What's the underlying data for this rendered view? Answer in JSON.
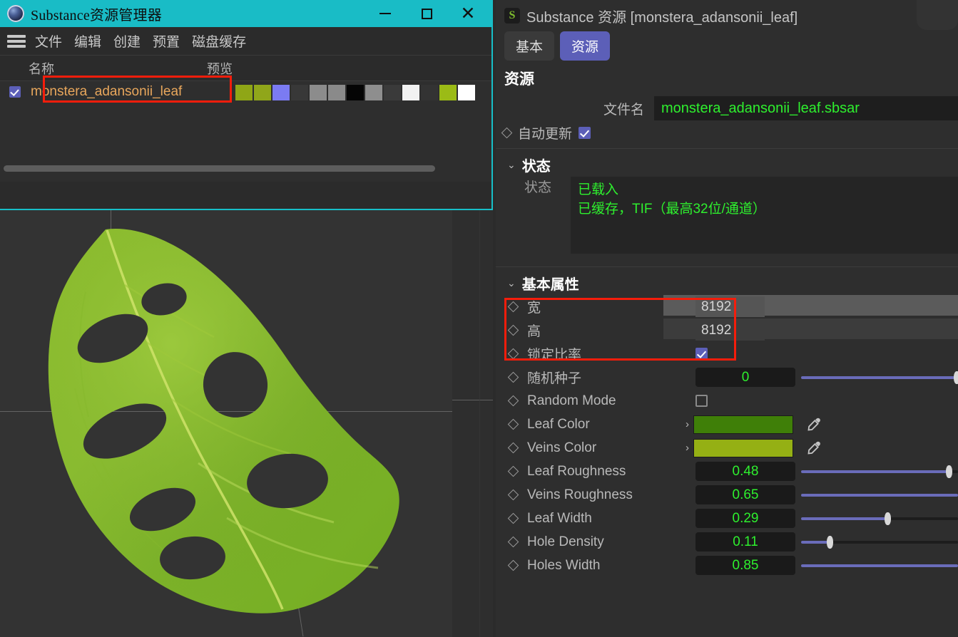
{
  "left_window": {
    "title": "Substance资源管理器",
    "app_icon": "substance-sphere-icon",
    "window_buttons": {
      "minimize": "minimize-icon",
      "maximize": "maximize-icon",
      "close": "close-icon"
    },
    "menu": {
      "hamburger": "hamburger-icon",
      "items": [
        "文件",
        "编辑",
        "创建",
        "预置",
        "磁盘缓存"
      ]
    },
    "list": {
      "columns": [
        "名称",
        "预览"
      ],
      "rows": [
        {
          "checked": true,
          "name": "monstera_adansonii_leaf",
          "highlighted": true
        }
      ],
      "thumbnail_colors": [
        "#8fa616",
        "#90a61a",
        "#7b7bf2",
        "#383838",
        "#8c8c8c",
        "#8a8a8a",
        "#050505",
        "#8e8e8e",
        "#3a3a3a",
        "#f2f2f2",
        "#333333",
        "#9bbb16",
        "#ffffff"
      ]
    }
  },
  "viewport": {
    "name": "3d-preview-viewport",
    "background": "#333333",
    "leaf_fill": "#7ab528",
    "leaf_highlight": "#a4cf3a",
    "hole_color": "#3a3a3a"
  },
  "right_panel": {
    "badge": "S",
    "title": "Substance 资源 [monstera_adansonii_leaf]",
    "tabs": [
      {
        "label": "基本",
        "active": false
      },
      {
        "label": "资源",
        "active": true
      }
    ],
    "section_title": "资源",
    "filename": {
      "label": "文件名",
      "value": "monstera_adansonii_leaf.sbsar"
    },
    "auto_update": {
      "label": "自动更新",
      "checked": true
    },
    "status_group": {
      "title": "状态",
      "field_label": "状态",
      "lines": [
        "已载入",
        "已缓存，TIF（最高32位/通道）"
      ]
    },
    "basic_group": {
      "title": "基本属性",
      "highlight_box": true,
      "params": [
        {
          "name": "宽",
          "type": "int",
          "value": "8192",
          "style": "plain-light"
        },
        {
          "name": "高",
          "type": "int",
          "value": "8192",
          "style": "plain-dark"
        },
        {
          "name": "锁定比率",
          "type": "checkbox",
          "checked": true
        },
        {
          "name": "随机种子",
          "type": "slider",
          "value": "0",
          "fill_pct": 100,
          "handle_pct": 99
        },
        {
          "name": "Random Mode",
          "type": "checkbox",
          "checked": false
        },
        {
          "name": "Leaf Color",
          "type": "color",
          "value": "#3f7f08"
        },
        {
          "name": "Veins Color",
          "type": "color",
          "value": "#95b014"
        },
        {
          "name": "Leaf Roughness",
          "type": "slider",
          "value": "0.48",
          "fill_pct": 94,
          "handle_pct": 94
        },
        {
          "name": "Veins Roughness",
          "type": "slider",
          "value": "0.65",
          "fill_pct": 100,
          "handle_pct": null
        },
        {
          "name": "Leaf Width",
          "type": "slider",
          "value": "0.29",
          "fill_pct": 55,
          "handle_pct": 55
        },
        {
          "name": "Hole Density",
          "type": "slider",
          "value": "0.11",
          "fill_pct": 18,
          "handle_pct": 18
        },
        {
          "name": "Holes Width",
          "type": "slider",
          "value": "0.85",
          "fill_pct": 100,
          "handle_pct": null
        }
      ]
    },
    "colors": {
      "accent": "#5c5fb8",
      "value_green": "#2ef02e",
      "slider_fill": "#6a6cba",
      "title_bar": "#19bcc6",
      "highlight_red": "#f51d0b",
      "filename_orange": "#e8a75c"
    }
  }
}
